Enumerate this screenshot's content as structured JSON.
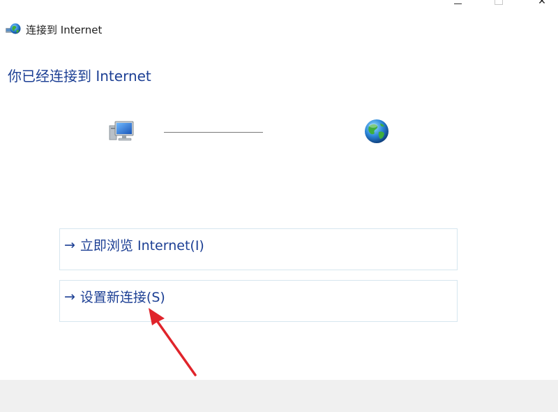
{
  "window": {
    "title": "连接到 Internet",
    "controls": {
      "minimize_icon": "minimize-icon",
      "maximize_icon": "maximize-icon",
      "close_glyph": "✕"
    }
  },
  "main": {
    "heading": "你已经连接到 Internet",
    "diagram": {
      "left_icon": "computer-icon",
      "right_icon": "globe-icon"
    },
    "links": [
      {
        "arrow": "→",
        "label": "立即浏览 Internet(I)"
      },
      {
        "arrow": "→",
        "label": "设置新连接(S)"
      }
    ]
  },
  "colors": {
    "heading": "#1c3f94",
    "link_text": "#1c3f94",
    "link_border": "#d6e6ef",
    "footer_bg": "#f0f0f0",
    "annotation": "#e0242b"
  },
  "annotation": {
    "type": "red-arrow",
    "points_to": "设置新连接(S)"
  }
}
